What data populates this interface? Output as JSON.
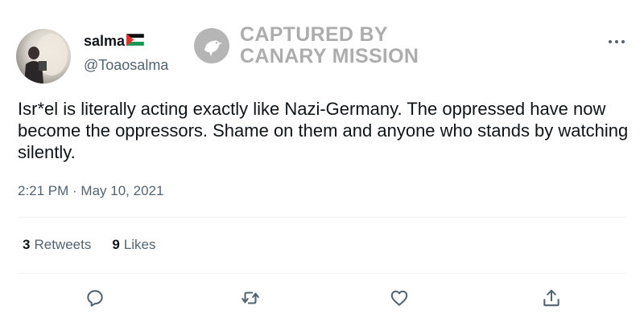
{
  "user": {
    "display_name": "salma",
    "handle": "@Toaosalma"
  },
  "watermark": {
    "line1": "CAPTURED BY",
    "line2": "CANARY MISSION"
  },
  "tweet": {
    "text": "Isr*el is literally acting exactly like Nazi-Germany. The oppressed have now become the oppressors. Shame on them and anyone who stands by watching silently.",
    "timestamp": "2:21 PM · May 10, 2021"
  },
  "stats": {
    "retweets_count": "3",
    "retweets_label": "Retweets",
    "likes_count": "9",
    "likes_label": "Likes"
  },
  "icons": {
    "more": "more-icon",
    "reply": "reply-icon",
    "retweet": "retweet-icon",
    "like": "heart-icon",
    "share": "share-icon",
    "flag": "palestine-flag-icon"
  },
  "colors": {
    "text_primary": "#0f1419",
    "text_secondary": "#536471",
    "divider": "#eff3f4"
  }
}
